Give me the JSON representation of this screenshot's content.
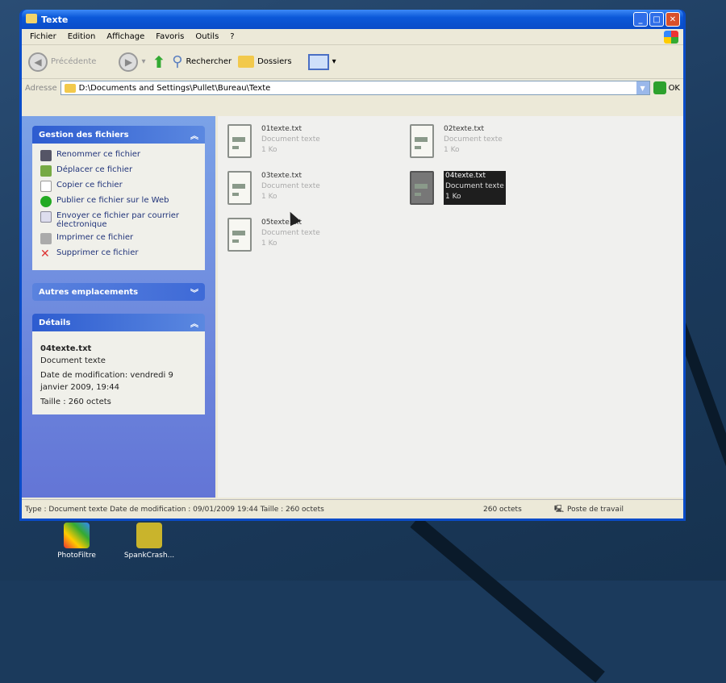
{
  "window": {
    "title": "Texte"
  },
  "menu": [
    "Fichier",
    "Edition",
    "Affichage",
    "Favoris",
    "Outils",
    "?"
  ],
  "toolbar": {
    "back": "Précédente",
    "search": "Rechercher",
    "folders": "Dossiers"
  },
  "address": {
    "label": "Adresse",
    "path": "D:\\Documents and Settings\\Pullet\\Bureau\\Texte",
    "go": "OK"
  },
  "file_tasks": {
    "title": "Gestion des fichiers",
    "items": [
      "Renommer ce fichier",
      "Déplacer ce fichier",
      "Copier ce fichier",
      "Publier ce fichier sur le Web",
      "Envoyer ce fichier par courrier électronique",
      "Imprimer ce fichier",
      "Supprimer ce fichier"
    ]
  },
  "other_places": {
    "title": "Autres emplacements"
  },
  "details": {
    "title": "Détails",
    "name": "04texte.txt",
    "type": "Document texte",
    "modified": "Date de modification: vendredi 9 janvier 2009, 19:44",
    "size": "Taille : 260 octets"
  },
  "files": [
    {
      "name": "01texte.txt",
      "type": "Document texte",
      "size": "1 Ko",
      "selected": false
    },
    {
      "name": "02texte.txt",
      "type": "Document texte",
      "size": "1 Ko",
      "selected": false
    },
    {
      "name": "03texte.txt",
      "type": "Document texte",
      "size": "1 Ko",
      "selected": false
    },
    {
      "name": "04texte.txt",
      "type": "Document texte",
      "size": "1 Ko",
      "selected": true
    },
    {
      "name": "05texte.txt",
      "type": "Document texte",
      "size": "1 Ko",
      "selected": false
    }
  ],
  "status": {
    "info": "Type : Document texte Date de modification : 09/01/2009 19:44 Taille : 260 octets",
    "size": "260 octets",
    "zone": "Poste de travail"
  },
  "desktop": {
    "icons": [
      "PhotoFiltre",
      "SpankCrash..."
    ]
  }
}
